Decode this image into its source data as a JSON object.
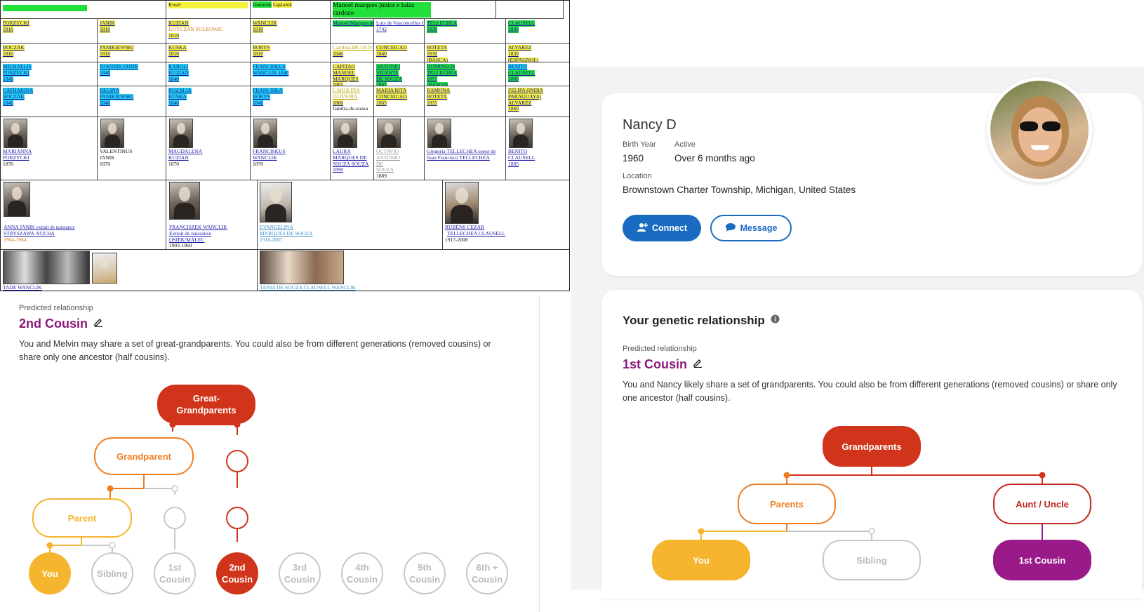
{
  "table": {
    "row0": [
      "",
      "Kosel",
      "Genovek",
      "Gąsiorek",
      "Manoel marques junior e luiza cardozo"
    ],
    "rows": [
      [
        [
          "PORZYCKI",
          "1810"
        ],
        [
          "JANIK",
          "1810"
        ],
        [
          "KUZIAN",
          "KOYCZAN SULKOWIC",
          "1810"
        ],
        [
          "WANCLIK",
          "1810"
        ],
        [
          "Manoel Marques de SOUZA"
        ],
        [
          "Luis de Vasconcellos Castelo Melhor de Souza",
          "1742"
        ],
        [
          "TELLECHEA",
          "1830"
        ],
        [
          "CLAUSELL",
          "1830"
        ]
      ],
      [
        [
          "BOCZAK",
          "1810"
        ],
        [
          "PANIKIEWSKI",
          "1810"
        ],
        [
          "KUSKA",
          "1810"
        ],
        [
          "BORYS",
          "1810"
        ],
        [
          "Carolina DE OLIVEIRA",
          "1840"
        ],
        [
          "CONCEICAO",
          "1840"
        ],
        [
          "ROTETA",
          "1830",
          "(BASCA)"
        ],
        [
          "ALVAREZ",
          "1830",
          "(ESPAGNOL)"
        ]
      ],
      [
        [
          "MICHAELIS",
          "PORZYCKI",
          "1840"
        ],
        [
          "JOANNIS JANIK",
          "1840"
        ],
        [
          "KAROLI",
          "KUZIAN",
          "1840"
        ],
        [
          "FRANCISKUS",
          "WANCLIK 1840"
        ],
        [
          "CAPITAO",
          "MANOEL",
          "MARQUES",
          "1865"
        ],
        [
          "ANTONIO",
          "VICENTE",
          "DE SOUZA",
          "1865"
        ],
        [
          "DOMINGOS",
          "TELLECHEA",
          "1855",
          "(BASCO)"
        ],
        [
          "BENITO",
          "CLAUSELL",
          "1860"
        ]
      ],
      [
        [
          "CATHARINA",
          "BOCZAK",
          "1840"
        ],
        [
          "REGINA",
          "PANIKIEWSKI",
          "1840"
        ],
        [
          "ROZALIA",
          "KUSKA",
          "1840"
        ],
        [
          "FRANCISKA",
          "BORYS",
          "1840"
        ],
        [
          "CAROLINA",
          "OLIVEIRA",
          "1860",
          "familia-de-souza"
        ],
        [
          "MARIA RITA",
          "CONCEICAO",
          "1865"
        ],
        [
          "RAMONA",
          "ROTETA",
          "1835"
        ],
        [
          "FELIPA (INDIA",
          "PARAGUAYA)",
          "ALVAREZ",
          "1860"
        ]
      ],
      [
        [
          "MARIANNA",
          "PORZYCKI",
          "1870"
        ],
        [
          "VALENTINUS",
          "JANIK",
          "1870"
        ],
        [
          "MAGDALENA",
          "KUZIAN",
          "1870"
        ],
        [
          "FRANCISKUS",
          "WANCLIK",
          "1870"
        ],
        [
          "LAURA",
          "MARQUES DE",
          "SOUZA SOUZA",
          "1890"
        ],
        [
          "OCTAVIO",
          "ANTONIO",
          "DE",
          "SOUZA",
          "1889"
        ],
        [
          "Gregoria TELLECHEA soeur de",
          "Joao Francisco TELLECHEA"
        ],
        [
          "BENITO",
          "CLAUSELL",
          "1885"
        ]
      ]
    ],
    "row6": [
      [
        "ANNA JANIK",
        "extrait de naissance",
        "STRYSZAWA /SUCHA",
        "1904-1984"
      ],
      [
        "FRANCISZEK WANCLIK",
        "Extrait de naissance",
        "OSIEK/MALEC",
        "1903-1969"
      ],
      [
        "EVANGELINA",
        "MARQUES DE SOUZA",
        "1918-2007"
      ],
      [
        "RUBENS CEZAR",
        "TELLECHEA CLAUSELL",
        "1917-2008"
      ]
    ],
    "row7": [
      "TADE WANCLIK",
      "TANIA DE SOUZA CLAUSELL WANCLIK"
    ]
  },
  "left_panel": {
    "predicted_label": "Predicted relationship",
    "relationship": "2nd Cousin",
    "description": "You and Melvin may share a set of great-grandparents. You could also be from different generations (removed cousins) or share only one ancestor (half cousins).",
    "tree": {
      "great_grandparents": "Great-\nGrandparents",
      "grandparent": "Grandparent",
      "parent": "Parent",
      "you": "You",
      "sibling": "Sibling",
      "cousins": [
        "1st\nCousin",
        "2nd\nCousin",
        "3rd\nCousin",
        "4th\nCousin",
        "5th\nCousin",
        "6th +\nCousin"
      ]
    }
  },
  "profile": {
    "name": "Nancy D",
    "birth_year_label": "Birth Year",
    "birth_year": "1960",
    "active_label": "Active",
    "active": "Over 6 months ago",
    "location_label": "Location",
    "location": "Brownstown Charter Township, Michigan, United States",
    "connect": "Connect",
    "message": "Message"
  },
  "right_panel": {
    "heading": "Your genetic relationship",
    "predicted_label": "Predicted relationship",
    "relationship": "1st Cousin",
    "description": "You and Nancy likely share a set of grandparents. You could also be from different generations (removed cousins) or share only one ancestor (half cousins).",
    "tree": {
      "grandparents": "Grandparents",
      "parents": "Parents",
      "aunt_uncle": "Aunt / Uncle",
      "you": "You",
      "sibling": "Sibling",
      "first_cousin": "1st Cousin"
    }
  },
  "colors": {
    "red": "#d0341a",
    "orange": "#ef7d22",
    "amber": "#f5b52e",
    "magenta": "#9a1a8a",
    "blue": "#1a6bc2",
    "grey": "#c8c8c8"
  }
}
